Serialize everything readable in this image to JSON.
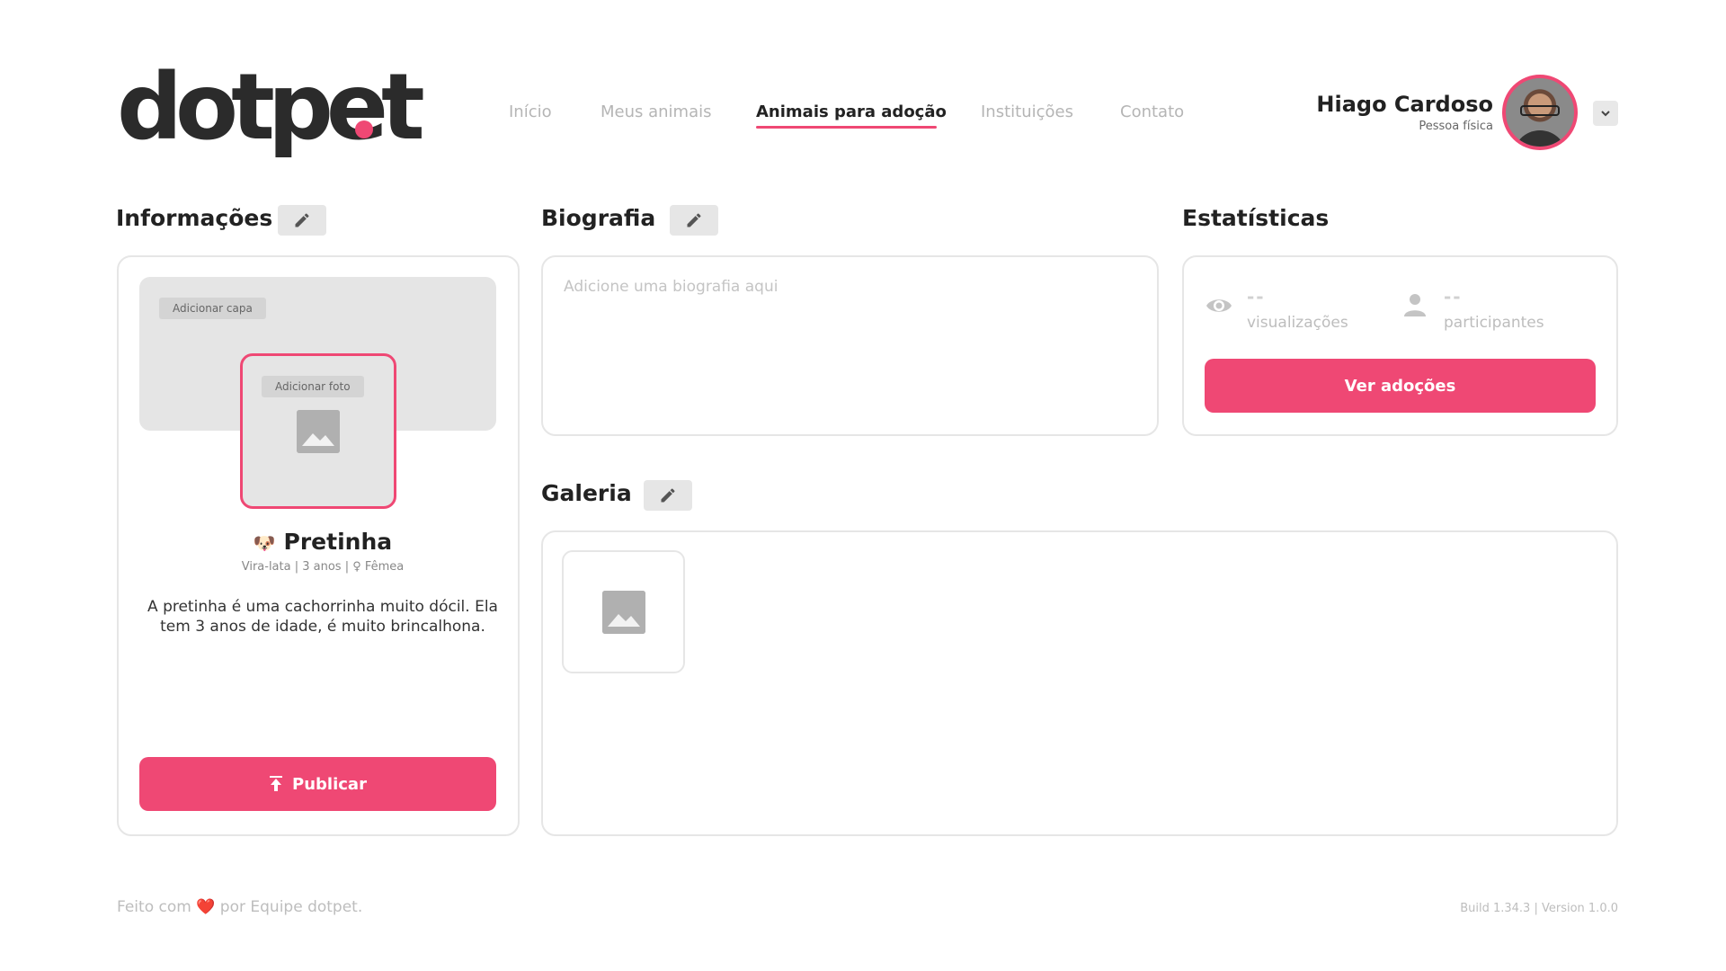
{
  "brand": {
    "logo_text": "dotpet",
    "accent_color": "#ef4874"
  },
  "nav": {
    "items": [
      {
        "label": "Início"
      },
      {
        "label": "Meus animais"
      },
      {
        "label": "Animais para adoção",
        "active": true
      },
      {
        "label": "Instituições"
      },
      {
        "label": "Contato"
      }
    ]
  },
  "user": {
    "name": "Hiago Cardoso",
    "role": "Pessoa física"
  },
  "info": {
    "title": "Informações",
    "add_cover_label": "Adicionar capa",
    "add_photo_label": "Adicionar foto",
    "pet_emoji": "🐶",
    "pet_name": "Pretinha",
    "pet_meta": "Vira-lata | 3 anos | ♀ Fêmea",
    "pet_description": "A pretinha é uma cachorrinha muito dócil. Ela tem 3 anos de idade, é muito brincalhona.",
    "publish_label": "Publicar"
  },
  "bio": {
    "title": "Biografia",
    "placeholder": "Adicione uma biografia aqui"
  },
  "stats": {
    "title": "Estatísticas",
    "views_value": "--",
    "views_label": "visualizações",
    "participants_value": "--",
    "participants_label": "participantes",
    "button_label": "Ver adoções"
  },
  "gallery": {
    "title": "Galeria"
  },
  "footer": {
    "made_with_prefix": "Feito com",
    "heart": "❤️",
    "made_with_suffix": "por Equipe dotpet.",
    "build": "Build 1.34.3 | Version 1.0.0"
  }
}
